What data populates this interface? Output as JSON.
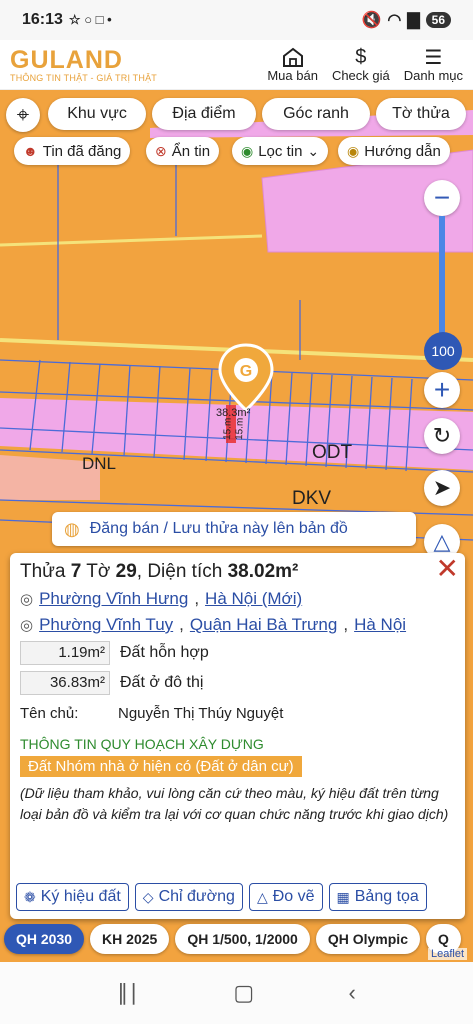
{
  "status_bar": {
    "time": "16:13",
    "notification_icons": "☆ ○ □ •",
    "battery": "56"
  },
  "header": {
    "logo": "GULAND",
    "tagline": "THÔNG TIN THẬT - GIÁ TRỊ THẬT",
    "nav": [
      {
        "label": "Mua bán",
        "icon": "house-icon"
      },
      {
        "label": "Check giá",
        "icon": "dollar-icon"
      },
      {
        "label": "Danh mục",
        "icon": "menu-icon"
      }
    ]
  },
  "filters": {
    "primary": [
      "Khu vực",
      "Địa điểm",
      "Góc ranh",
      "Tờ thửa"
    ],
    "secondary": [
      "Tin đã đăng",
      "Ẩn tin",
      "Lọc tin",
      "Hướng dẫn"
    ]
  },
  "map": {
    "zoom_level": "100",
    "labels": {
      "odt": "ODT",
      "dnl": "DNL",
      "dkv": "DKV",
      "area": "38.3m²",
      "dim1": "15.m",
      "dim2": "15.m"
    },
    "colors": {
      "orange": "#f2a33f",
      "pink": "#f0a8e8",
      "blue_line": "#4b6bd8"
    }
  },
  "post_banner": "Đăng bán / Lưu thửa này lên bản đồ",
  "parcel": {
    "title_prefix": "Thửa",
    "parcel_no": "7",
    "sheet_label": "Tờ",
    "sheet_no": "29",
    "area_label": ", Diện tích",
    "area": "38.02m²",
    "address_new": {
      "ward": "Phường Vĩnh Hưng",
      "city": "Hà Nội (Mới)"
    },
    "address_old": {
      "ward": "Phường Vĩnh Tuy",
      "district": "Quận Hai Bà Trưng",
      "city": "Hà Nội"
    },
    "land_use": [
      {
        "area": "1.19m²",
        "type": "Đất hỗn hợp"
      },
      {
        "area": "36.83m²",
        "type": "Đất ở đô thị"
      }
    ],
    "owner_label": "Tên chủ:",
    "owner_name": "Nguyễn Thị Thúy Nguyệt",
    "plan_title": "THÔNG TIN QUY HOẠCH XÂY DỰNG",
    "plan_type": "Đất Nhóm nhà ở hiện có (Đất ở dân cư)",
    "disclaimer": "(Dữ liệu tham khảo, vui lòng căn cứ theo màu, ký hiệu đất trên từng loại bản đồ và kiểm tra lại với cơ quan chức năng trước khi giao dịch)",
    "actions": [
      "Ký hiệu đất",
      "Chỉ đường",
      "Đo vẽ",
      "Bảng tọa"
    ]
  },
  "plan_tabs": [
    "QH 2030",
    "KH 2025",
    "QH 1/500, 1/2000",
    "QH Olympic",
    "Q"
  ],
  "attribution": "Leaflet"
}
